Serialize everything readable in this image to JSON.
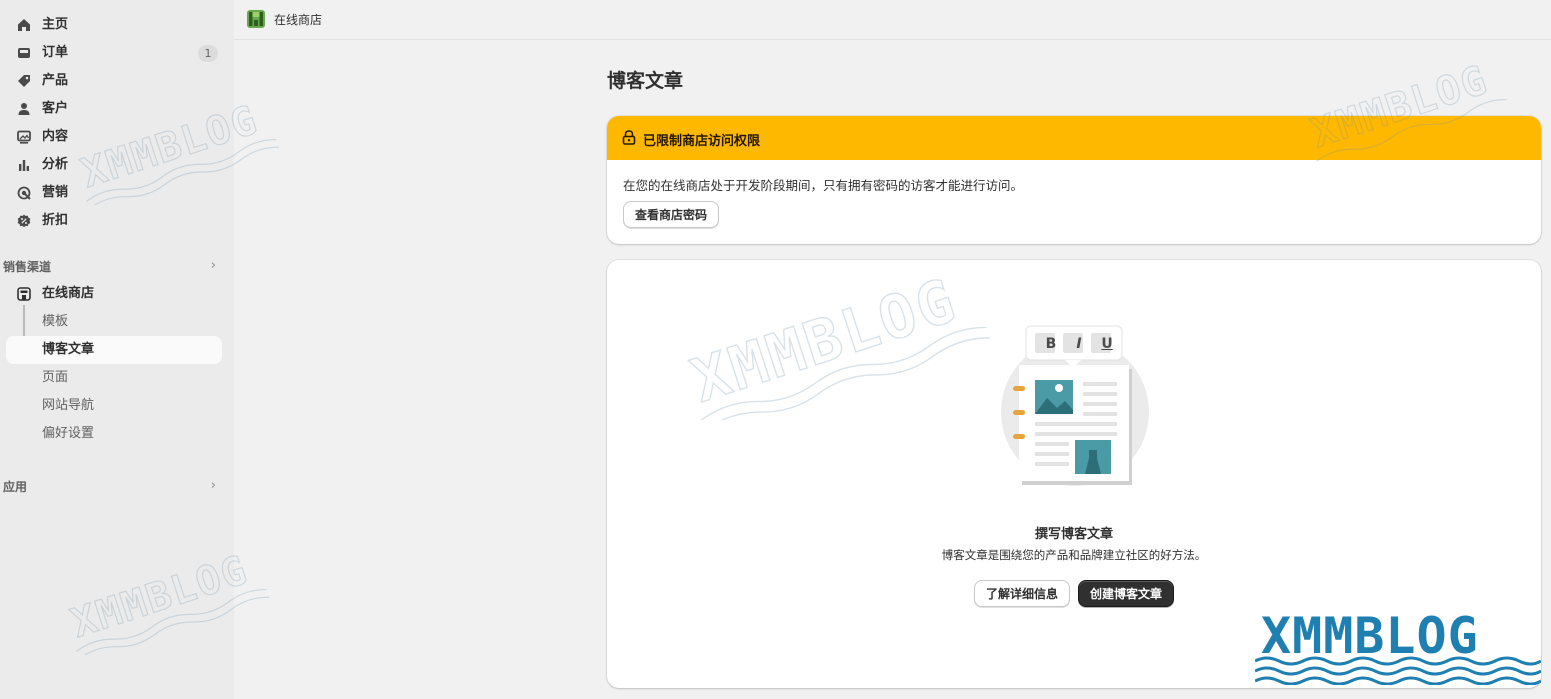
{
  "topbar": {
    "store_name": "在线商店"
  },
  "sidebar": {
    "nav": [
      {
        "label": "主页",
        "icon": "home-icon"
      },
      {
        "label": "订单",
        "icon": "inbox-icon",
        "badge": "1"
      },
      {
        "label": "产品",
        "icon": "tag-icon"
      },
      {
        "label": "客户",
        "icon": "person-icon"
      },
      {
        "label": "内容",
        "icon": "image-icon"
      },
      {
        "label": "分析",
        "icon": "bar-chart-icon"
      },
      {
        "label": "营销",
        "icon": "target-icon"
      },
      {
        "label": "折扣",
        "icon": "discount-icon"
      }
    ],
    "sales_channels": {
      "heading": "销售渠道",
      "store": "在线商店",
      "sub_items": [
        "模板",
        "博客文章",
        "页面",
        "网站导航",
        "偏好设置"
      ],
      "active_index": 1
    },
    "apps": {
      "heading": "应用"
    }
  },
  "main": {
    "title": "博客文章",
    "banner": {
      "title": "已限制商店访问权限",
      "body": "在您的在线商店处于开发阶段期间，只有拥有密码的访客才能进行访问。",
      "button": "查看商店密码",
      "color": "#ffb800"
    },
    "empty_state": {
      "toolbar": [
        "B",
        "I",
        "U"
      ],
      "title": "撰写博客文章",
      "description": "博客文章是围绕您的产品和品牌建立社区的好方法。",
      "secondary_button": "了解详细信息",
      "primary_button": "创建博客文章"
    }
  },
  "watermark": {
    "text": "XMMBLOG",
    "color": "#1f7fb0"
  }
}
